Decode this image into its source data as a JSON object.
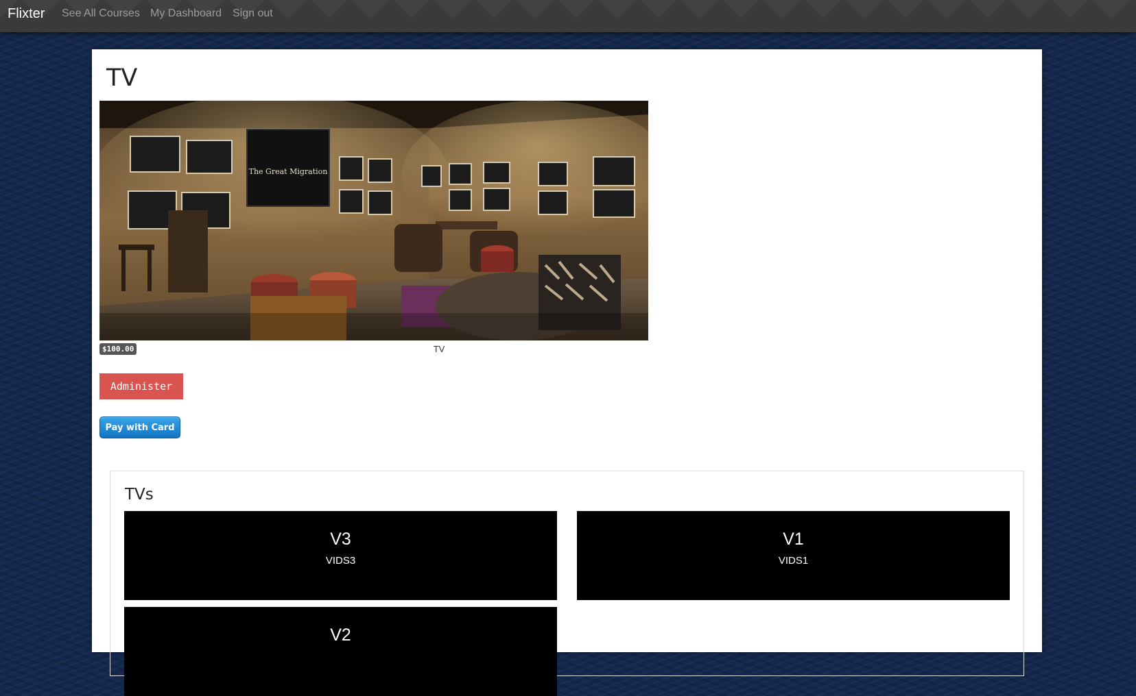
{
  "navbar": {
    "brand": "Flixter",
    "links": [
      {
        "label": "See All Courses"
      },
      {
        "label": "My Dashboard"
      },
      {
        "label": "Sign out"
      }
    ]
  },
  "course": {
    "title": "TV",
    "image_alt": "Room with framed photos and a screen showing The Great Migration",
    "screen_text": "The Great Migration",
    "price": "$100.00",
    "caption": "TV",
    "administer_label": "Administer",
    "pay_label": "Pay with Card"
  },
  "section": {
    "title": "TVs",
    "videos": [
      {
        "title": "V3",
        "subtitle": "VIDS3"
      },
      {
        "title": "V1",
        "subtitle": "VIDS1"
      },
      {
        "title": "V2",
        "subtitle": ""
      }
    ]
  },
  "colors": {
    "navbar": "#3a3a3a",
    "background": "#14284d",
    "administer": "#d9534f",
    "pay_button": "#1a85d6",
    "video_card": "#000000"
  }
}
